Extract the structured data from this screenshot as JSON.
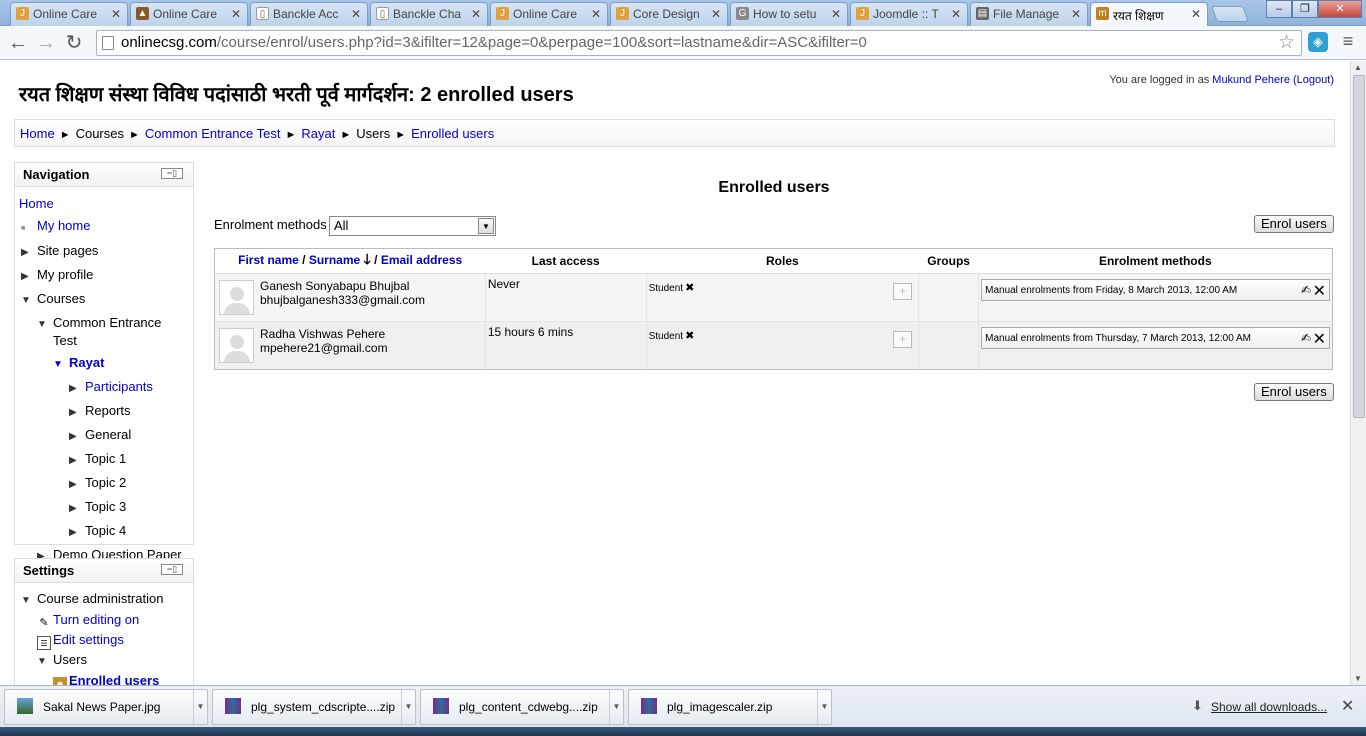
{
  "browser": {
    "tabs": [
      {
        "title": "Online Care",
        "color": "#e0a040",
        "glyph": "J"
      },
      {
        "title": "Online Care",
        "color": "#8b5a2b",
        "glyph": "▲"
      },
      {
        "title": "Banckle Acc",
        "color": "#ffffff",
        "glyph": "▯"
      },
      {
        "title": "Banckle Cha",
        "color": "#ffffff",
        "glyph": "▯"
      },
      {
        "title": "Online Care",
        "color": "#e0a040",
        "glyph": "J"
      },
      {
        "title": "Core Design",
        "color": "#e0a040",
        "glyph": "J"
      },
      {
        "title": "How to setu",
        "color": "#888888",
        "glyph": "G"
      },
      {
        "title": "Joomdle :: T",
        "color": "#e0a040",
        "glyph": "J"
      },
      {
        "title": "File Manage",
        "color": "#666666",
        "glyph": "▤"
      },
      {
        "title": "रयत शिक्षण",
        "color": "#c08020",
        "glyph": "m"
      }
    ],
    "url_host": "onlinecsg.com",
    "url_path": "/course/enrol/users.php?id=3&ifilter=12&page=0&perpage=100&sort=lastname&dir=ASC&ifilter=0"
  },
  "page": {
    "title": "रयत शिक्षण संस्था विविध पदांसाठी भरती पूर्व मार्गदर्शन: 2 enrolled users",
    "login_prefix": "You are logged in as",
    "login_user": "Mukund Pehere",
    "logout": "(Logout)"
  },
  "breadcrumb": [
    "Home",
    "Courses",
    "Common Entrance Test",
    "Rayat",
    "Users",
    "Enrolled users"
  ],
  "navigation": {
    "title": "Navigation",
    "home": "Home",
    "my_home": "My home",
    "site_pages": "Site pages",
    "my_profile": "My profile",
    "courses": "Courses",
    "course1_a": "Common Entrance",
    "course1_b": "Test",
    "rayat": "Rayat",
    "participants": "Participants",
    "reports": "Reports",
    "general": "General",
    "topic1": "Topic 1",
    "topic2": "Topic 2",
    "topic3": "Topic 3",
    "topic4": "Topic 4",
    "demo": "Demo Question Paper"
  },
  "settings": {
    "title": "Settings",
    "course_admin": "Course administration",
    "turn_editing": "Turn editing on",
    "edit_settings": "Edit settings",
    "users": "Users",
    "enrolled_users": "Enrolled users"
  },
  "main": {
    "heading": "Enrolled users",
    "enrol_methods_label": "Enrolment methods",
    "enrol_methods_value": "All",
    "enrol_button": "Enrol users",
    "columns": {
      "first_name": "First name",
      "surname": "Surname",
      "email": "Email address",
      "last_access": "Last access",
      "roles": "Roles",
      "groups": "Groups",
      "enrolment_methods": "Enrolment methods"
    },
    "users": [
      {
        "name": "Ganesh Sonyabapu Bhujbal",
        "email": "bhujbalganesh333@gmail.com",
        "last_access": "Never",
        "role": "Student",
        "enrolment": "Manual enrolments from Friday, 8 March 2013, 12:00 AM"
      },
      {
        "name": "Radha Vishwas Pehere",
        "email": "mpehere21@gmail.com",
        "last_access": "15 hours 6 mins",
        "role": "Student",
        "enrolment": "Manual enrolments from Thursday, 7 March 2013, 12:00 AM"
      }
    ]
  },
  "downloads": {
    "items": [
      "Sakal News Paper.jpg",
      "plg_system_cdscripte....zip",
      "plg_content_cdwebg....zip",
      "plg_imagescaler.zip"
    ],
    "show_all": "Show all downloads..."
  }
}
